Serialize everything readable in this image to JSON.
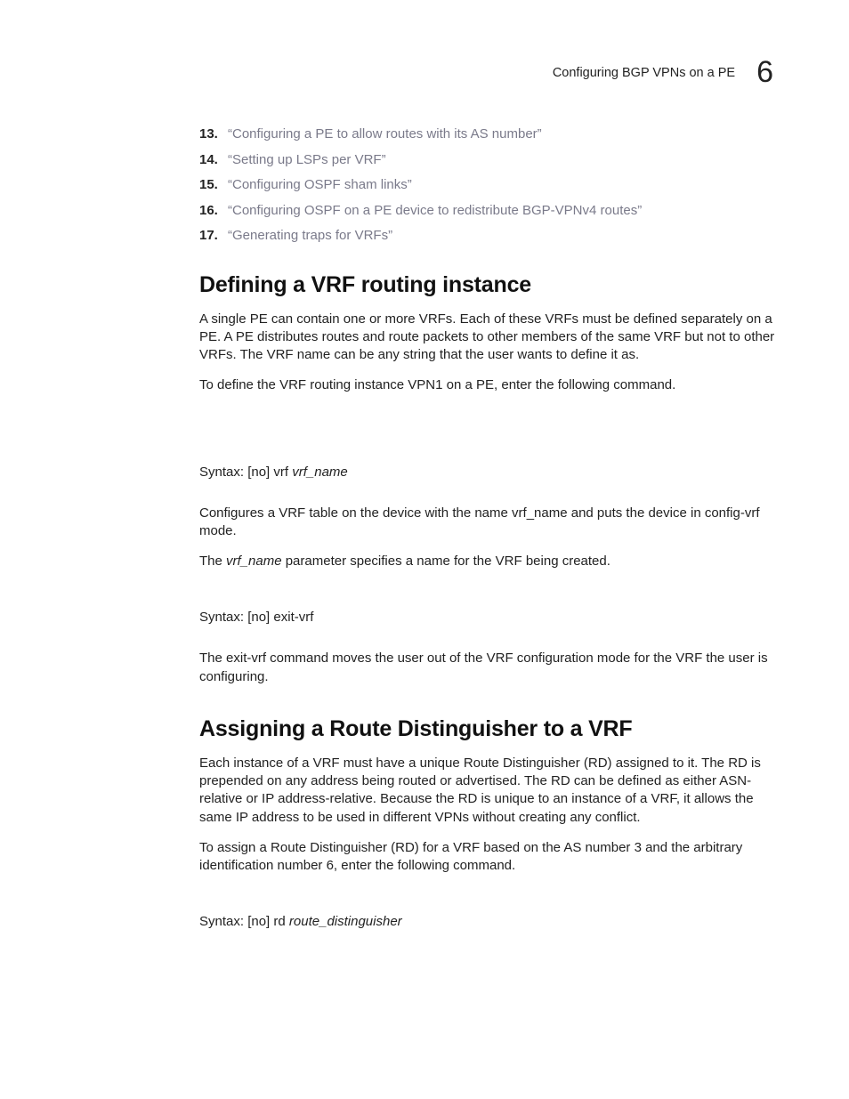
{
  "header": {
    "running_title": "Configuring BGP VPNs on a PE",
    "chapter_number": "6"
  },
  "steps": [
    {
      "n": "13.",
      "text": "“Configuring a PE to allow routes with its AS number”"
    },
    {
      "n": "14.",
      "text": "“Setting up LSPs per VRF”"
    },
    {
      "n": "15.",
      "text": "“Configuring OSPF sham links”"
    },
    {
      "n": "16.",
      "text": "“Configuring OSPF on a PE device to redistribute BGP-VPNv4 routes”"
    },
    {
      "n": "17.",
      "text": "“Generating traps for VRFs”"
    }
  ],
  "sectionA": {
    "heading": "Defining a VRF routing instance",
    "p1": "A single PE can contain one or more VRFs. Each of these VRFs must be defined separately on a PE. A PE distributes routes and route packets to other members of the same VRF but not to other VRFs. The VRF name can be any string that the user wants to define it as.",
    "p2": "To define the VRF routing instance VPN1 on a PE, enter the following command.",
    "syntax1_label": "Syntax:  ",
    "syntax1_cmd": "[no] vrf ",
    "syntax1_var": "vrf_name",
    "p3": "Configures a VRF table on the device with the name vrf_name and puts the device in config-vrf mode.",
    "p4a": "The ",
    "p4_var": "vrf_name",
    "p4b": " parameter specifies a name for the VRF being created.",
    "syntax2_label": "Syntax:  ",
    "syntax2_cmd": "[no] exit-vrf",
    "p5": "The exit-vrf command moves the user out of the VRF configuration mode for the VRF the user is configuring."
  },
  "sectionB": {
    "heading": "Assigning a Route Distinguisher to a VRF",
    "p1": "Each instance of a VRF must have a unique Route Distinguisher (RD) assigned to it. The RD is prepended on any address being routed or advertised. The RD can be defined as either ASN-relative or IP address-relative. Because the RD is unique to an instance of a VRF, it allows the same IP address to be used in different VPNs without creating any conflict.",
    "p2": "To assign a Route Distinguisher (RD) for a VRF based on the AS number 3 and the arbitrary identification number 6, enter the following command.",
    "syntax1_label": "Syntax:  ",
    "syntax1_cmd": "[no] rd ",
    "syntax1_var": "route_distinguisher"
  }
}
